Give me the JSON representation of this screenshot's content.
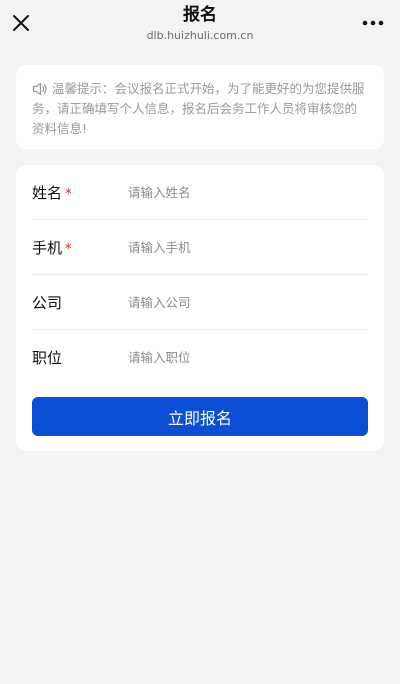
{
  "header": {
    "title": "报名",
    "url": "dlb.huizhuli.com.cn",
    "close_icon": "close-icon",
    "more_icon": "more-dots-icon"
  },
  "notice": {
    "icon": "speaker-icon",
    "text": "温馨提示：会议报名正式开始，为了能更好的为您提供服务，请正确填写个人信息，报名后会务工作人员将审核您的资料信息!"
  },
  "form": {
    "fields": [
      {
        "label": "姓名",
        "required": true,
        "required_mark": "*",
        "placeholder": "请输入姓名",
        "value": ""
      },
      {
        "label": "手机",
        "required": true,
        "required_mark": "*",
        "placeholder": "请输入手机",
        "value": ""
      },
      {
        "label": "公司",
        "required": false,
        "placeholder": "请输入公司",
        "value": ""
      },
      {
        "label": "职位",
        "required": false,
        "placeholder": "请输入职位",
        "value": ""
      }
    ],
    "submit_label": "立即报名"
  },
  "colors": {
    "accent": "#0a4fd6",
    "required": "#e02020",
    "background": "#f2f3f5"
  }
}
